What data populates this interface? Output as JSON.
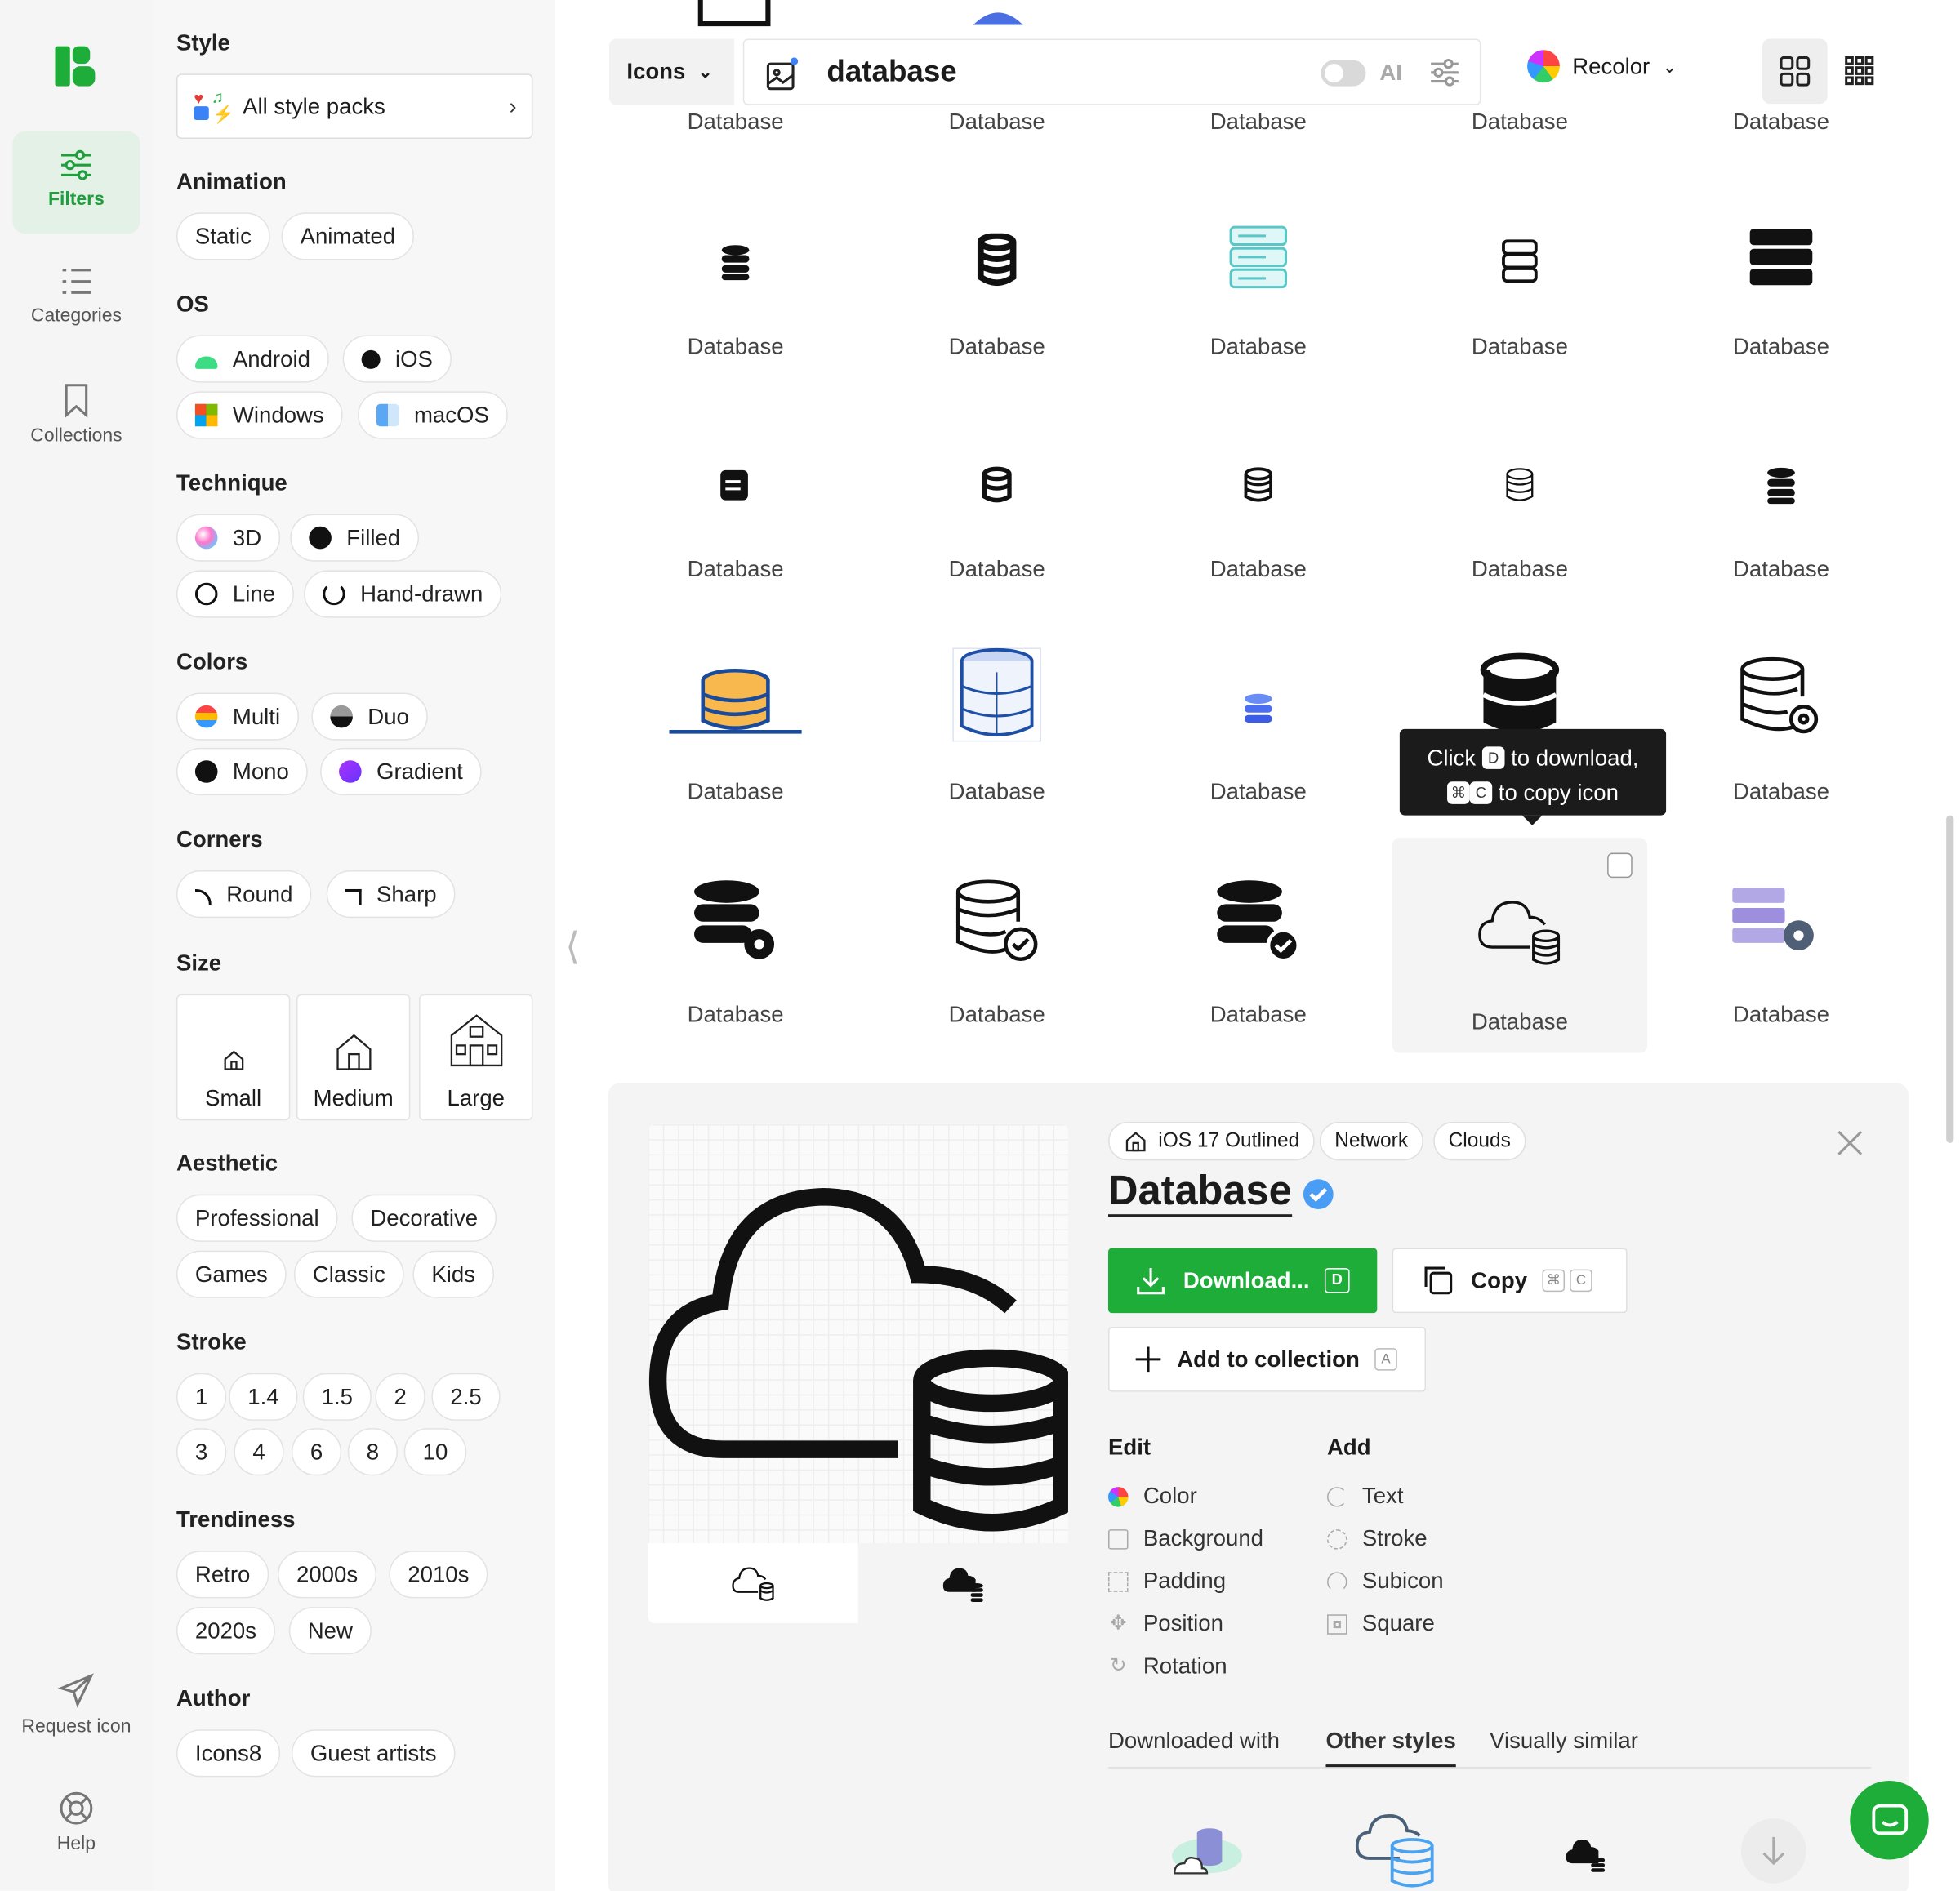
{
  "rail": {
    "filters": "Filters",
    "categories": "Categories",
    "collections": "Collections",
    "request": "Request icon",
    "help": "Help"
  },
  "filters": {
    "style_title": "Style",
    "style_value": "All style packs",
    "animation_title": "Animation",
    "animation": [
      "Static",
      "Animated"
    ],
    "os_title": "OS",
    "os": [
      "Android",
      "iOS",
      "Windows",
      "macOS"
    ],
    "technique_title": "Technique",
    "technique": [
      "3D",
      "Filled",
      "Line",
      "Hand-drawn"
    ],
    "colors_title": "Colors",
    "colors": [
      "Multi",
      "Duo",
      "Mono",
      "Gradient"
    ],
    "corners_title": "Corners",
    "corners": [
      "Round",
      "Sharp"
    ],
    "size_title": "Size",
    "sizes": [
      "Small",
      "Medium",
      "Large"
    ],
    "aesthetic_title": "Aesthetic",
    "aesthetic": [
      "Professional",
      "Decorative",
      "Games",
      "Classic",
      "Kids"
    ],
    "stroke_title": "Stroke",
    "stroke": [
      "1",
      "1.4",
      "1.5",
      "2",
      "2.5",
      "3",
      "4",
      "6",
      "8",
      "10"
    ],
    "trendiness_title": "Trendiness",
    "trendiness": [
      "Retro",
      "2000s",
      "2010s",
      "2020s",
      "New"
    ],
    "author_title": "Author",
    "author": [
      "Icons8",
      "Guest artists"
    ]
  },
  "search": {
    "type": "Icons",
    "query": "database",
    "ai_label": "AI",
    "recolor": "Recolor"
  },
  "results": {
    "label": "Database"
  },
  "tooltip": {
    "click": "Click",
    "key_download": "D",
    "to_download": "to download,",
    "key_cmd": "⌘",
    "key_c": "C",
    "to_copy": "to copy icon"
  },
  "detail": {
    "tags": [
      "iOS 17 Outlined",
      "Network",
      "Clouds"
    ],
    "title": "Database",
    "download": "Download...",
    "download_key": "D",
    "copy": "Copy",
    "copy_keys": [
      "⌘",
      "C"
    ],
    "add_collection": "Add to collection",
    "add_key": "A",
    "edit_title": "Edit",
    "edit": [
      "Color",
      "Background",
      "Padding",
      "Position",
      "Rotation"
    ],
    "add_title": "Add",
    "add": [
      "Text",
      "Stroke",
      "Subicon",
      "Square"
    ],
    "tabs": [
      "Downloaded with",
      "Other styles",
      "Visually similar"
    ]
  },
  "colors": {
    "brand_green": "#1fad3a",
    "accent_blue": "#3b82f6"
  }
}
